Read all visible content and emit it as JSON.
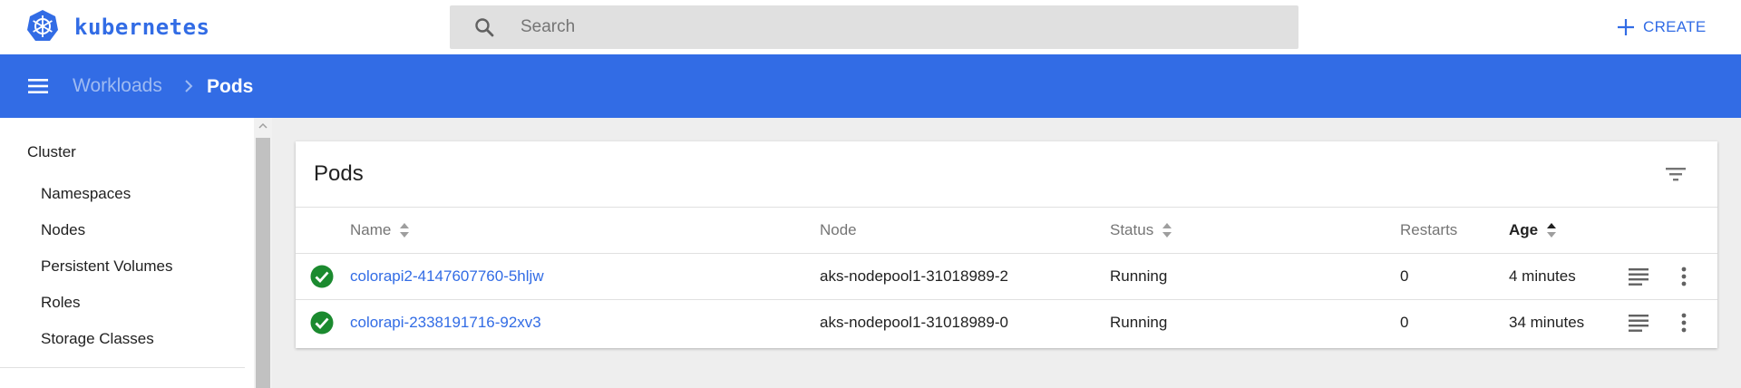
{
  "header": {
    "brand": "kubernetes",
    "search_placeholder": "Search",
    "create_label": "CREATE"
  },
  "breadcrumb": {
    "parent": "Workloads",
    "current": "Pods"
  },
  "sidebar": {
    "section_title": "Cluster",
    "items": [
      {
        "label": "Namespaces"
      },
      {
        "label": "Nodes"
      },
      {
        "label": "Persistent Volumes"
      },
      {
        "label": "Roles"
      },
      {
        "label": "Storage Classes"
      }
    ]
  },
  "card": {
    "title": "Pods",
    "columns": {
      "name": "Name",
      "node": "Node",
      "status": "Status",
      "restarts": "Restarts",
      "age": "Age"
    },
    "rows": [
      {
        "name": "colorapi2-4147607760-5hljw",
        "node": "aks-nodepool1-31018989-2",
        "status": "Running",
        "restarts": "0",
        "age": "4 minutes"
      },
      {
        "name": "colorapi-2338191716-92xv3",
        "node": "aks-nodepool1-31018989-0",
        "status": "Running",
        "restarts": "0",
        "age": "34 minutes"
      }
    ]
  },
  "icons": {
    "logo": "kubernetes-logo-icon",
    "search": "search-icon",
    "create": "plus-icon",
    "menu": "menu-icon",
    "filter": "filter-icon",
    "status_ok": "check-circle-icon",
    "logs": "logs-icon",
    "more": "more-vert-icon"
  },
  "colors": {
    "brand": "#326ce5",
    "status_ok": "#1b8a2f",
    "breadcrumb_parent": "#9fbbf2"
  }
}
